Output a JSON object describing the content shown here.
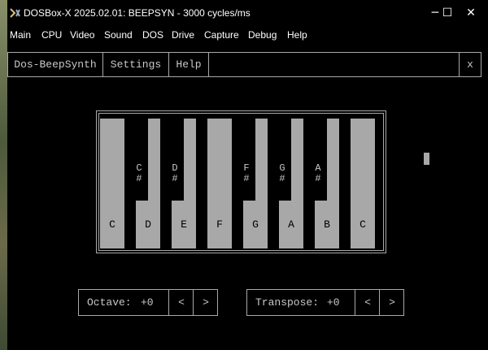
{
  "window": {
    "title": "DOSBox-X 2025.02.01: BEEPSYN - 3000 cycles/ms",
    "minimize": "─",
    "maximize": "☐",
    "close": "✕"
  },
  "menubar": {
    "items": [
      "Main",
      "CPU",
      "Video",
      "Sound",
      "DOS",
      "Drive",
      "Capture",
      "Debug",
      "Help"
    ]
  },
  "app": {
    "title": "Dos-BeepSynth",
    "settings": "Settings",
    "help": "Help",
    "close": "x"
  },
  "keyboard": {
    "white_keys": [
      "C",
      "D",
      "E",
      "F",
      "G",
      "A",
      "B",
      "C"
    ],
    "black_keys": [
      {
        "note": "C",
        "sharp": "#"
      },
      {
        "note": "D",
        "sharp": "#"
      },
      {
        "note": "F",
        "sharp": "#"
      },
      {
        "note": "G",
        "sharp": "#"
      },
      {
        "note": "A",
        "sharp": "#"
      }
    ]
  },
  "octave": {
    "label": "Octave:",
    "value": "+0",
    "dec": "<",
    "inc": ">"
  },
  "transpose": {
    "label": "Transpose:",
    "value": "+0",
    "dec": "<",
    "inc": ">"
  }
}
